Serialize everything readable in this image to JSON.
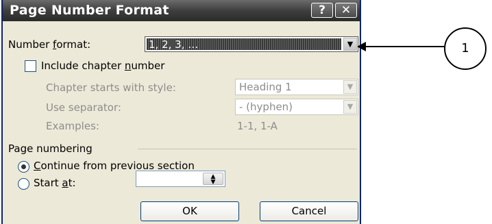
{
  "dialog": {
    "title": "Page Number Format",
    "help_button": "?",
    "close_button": "✕"
  },
  "number_format": {
    "label_pre": "Number ",
    "label_accel": "f",
    "label_post": "ormat:",
    "value": "1, 2, 3, …"
  },
  "include_chapter": {
    "label_pre": "Include chapter ",
    "label_accel": "n",
    "label_post": "umber",
    "checked": false
  },
  "chapter_style": {
    "label": "Chapter starts with style:",
    "value": "Heading 1"
  },
  "separator": {
    "label": "Use separator:",
    "value": "-  (hyphen)"
  },
  "examples": {
    "label": "Examples:",
    "value": "1-1, 1-A"
  },
  "page_numbering": {
    "group_label": "Page numbering",
    "continue_accel": "C",
    "continue_rest": "ontinue from previous section",
    "continue_selected": true,
    "start_pre": "Start ",
    "start_accel": "a",
    "start_post": "t:",
    "start_value": ""
  },
  "buttons": {
    "ok": "OK",
    "cancel": "Cancel"
  },
  "annotation": {
    "number": "1"
  },
  "icons": {
    "dropdown": "chevron-down-icon",
    "spinner": "spin-updown-icon",
    "radio_selected": "radio-dot",
    "help": "question-icon",
    "close": "close-icon"
  }
}
